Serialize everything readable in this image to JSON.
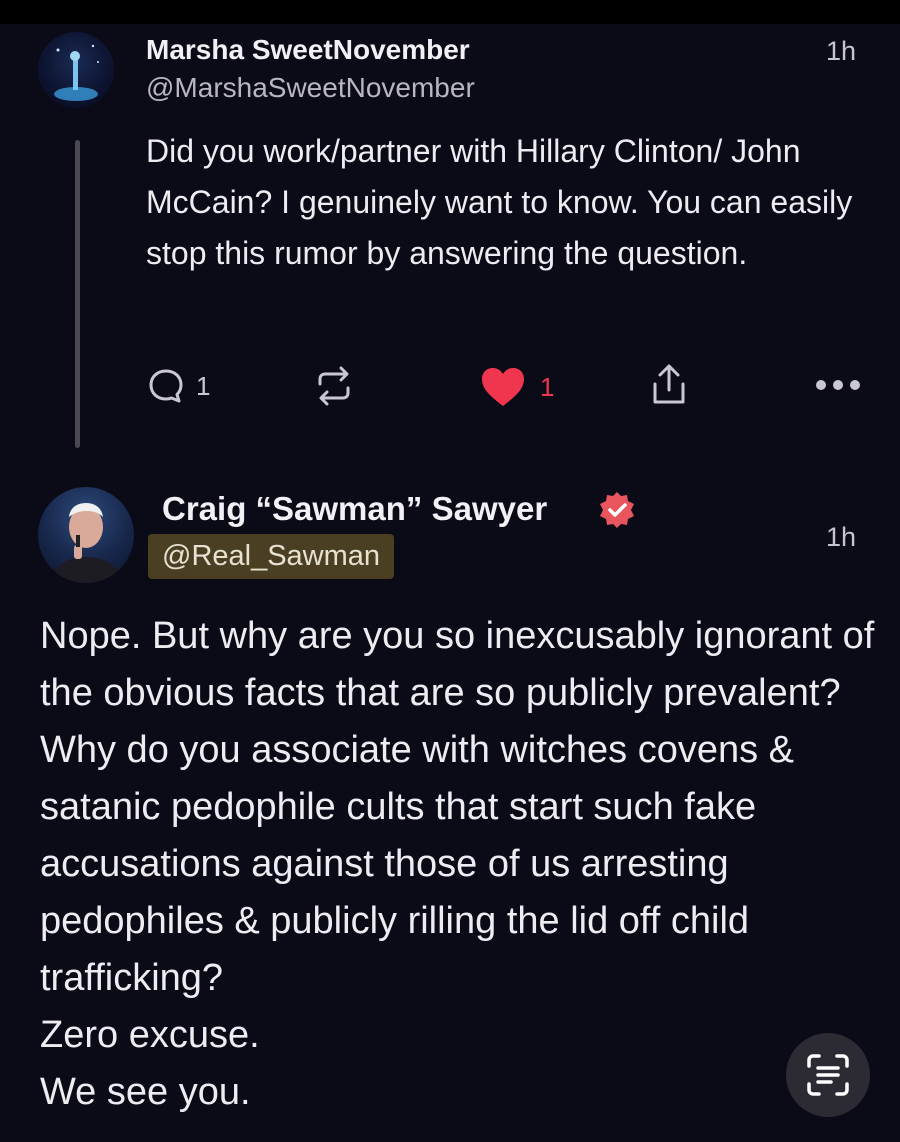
{
  "reply_parent": {
    "display_name": "Marsha SweetNovember",
    "handle": "@MarshaSweetNovember",
    "time": "1h",
    "text": "Did you work/partner with Hillary Clinton/ John McCain? I genuinely want to know. You can easily stop this rumor by answering the question.",
    "actions": {
      "reply_count": "1",
      "like_count": "1"
    }
  },
  "reply": {
    "display_name": "Craig “Sawman” Sawyer",
    "handle": "@Real_Sawman",
    "time": "1h",
    "paragraphs": [
      "Nope. But why are you so inexcusably ignorant of the obvious facts that are so publicly prevalent? Why do you associate with witches covens & satanic pedophile cults that start such fake accusations against those of us arresting pedophiles & publicly rilling the lid off child trafficking?",
      "Zero excuse.",
      "We see you."
    ]
  },
  "colors": {
    "background": "#0b0a17",
    "like_red": "#f0364f",
    "verified_badge": "#e8555c",
    "handle_highlight": "#4a3f22"
  },
  "icons": [
    "reply-icon",
    "repost-icon",
    "heart-icon",
    "share-icon",
    "more-icon",
    "verified-badge-icon",
    "text-scan-icon"
  ]
}
